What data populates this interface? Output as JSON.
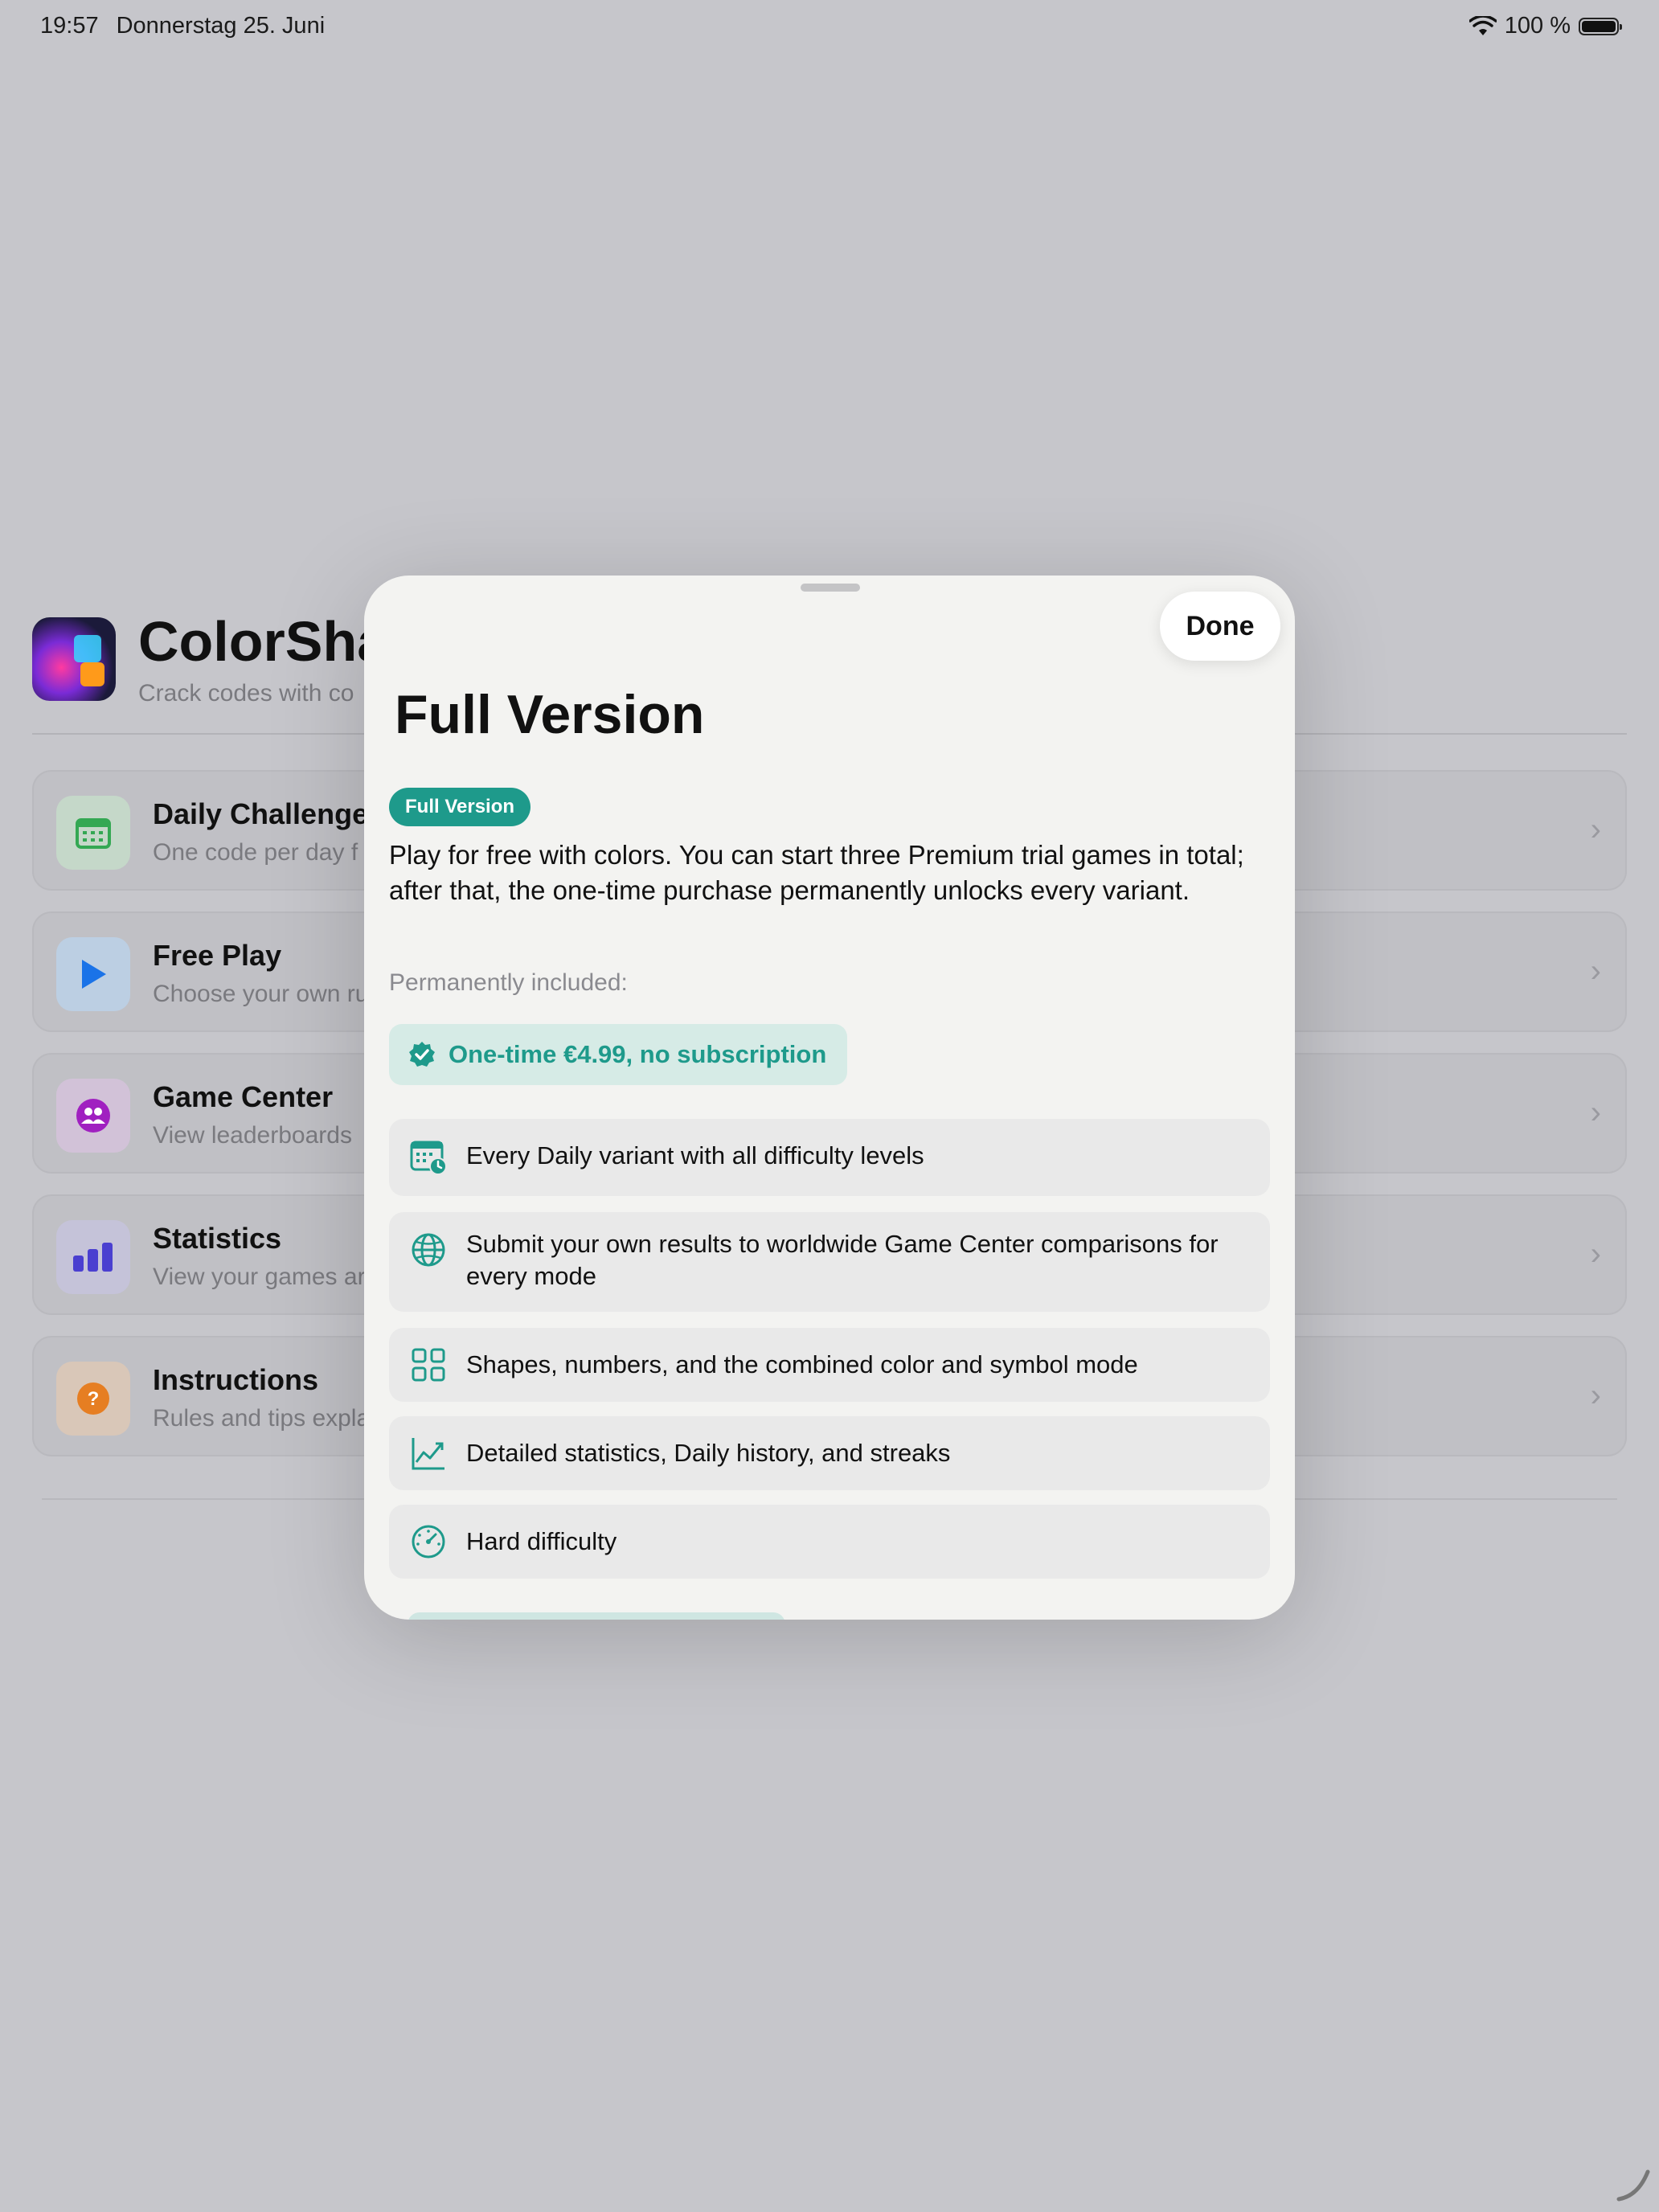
{
  "status_bar": {
    "time": "19:57",
    "date": "Donnerstag 25. Juni",
    "battery": "100 %"
  },
  "background_app": {
    "title": "ColorSha",
    "subtitle": "Crack codes with co",
    "menu": [
      {
        "title": "Daily Challenge",
        "subtitle": "One code per day f",
        "icon": "calendar-icon",
        "color": "#34a853"
      },
      {
        "title": "Free Play",
        "subtitle": "Choose your own ru",
        "icon": "play-icon",
        "color": "#1a73e8"
      },
      {
        "title": "Game Center",
        "subtitle": "View leaderboards",
        "icon": "person-icon",
        "color": "#a020c0"
      },
      {
        "title": "Statistics",
        "subtitle": "View your games ar",
        "icon": "bar-chart-icon",
        "color": "#4a3fd0"
      },
      {
        "title": "Instructions",
        "subtitle": "Rules and tips expla",
        "icon": "question-icon",
        "color": "#e67e22"
      }
    ]
  },
  "sheet": {
    "done_label": "Done",
    "title": "Full Version",
    "badge": "Full Version",
    "description": "Play for free with colors. You can start three Premium trial games in total; after that, the one-time purchase permanently unlocks every variant.",
    "permanently_included": "Permanently included:",
    "price": "One-time €4.99, no subscription",
    "features": [
      {
        "icon": "calendar-clock-icon",
        "text": "Every Daily variant with all difficulty levels"
      },
      {
        "icon": "globe-icon",
        "text": "Submit your own results to worldwide Game Center comparisons for every mode"
      },
      {
        "icon": "grid-icon",
        "text": "Shapes, numbers, and the combined color and symbol mode"
      },
      {
        "icon": "chart-line-icon",
        "text": "Detailed statistics, Daily history, and streaks"
      },
      {
        "icon": "gauge-icon",
        "text": "Hard difficulty"
      }
    ],
    "accent": "#1e9a8b"
  }
}
